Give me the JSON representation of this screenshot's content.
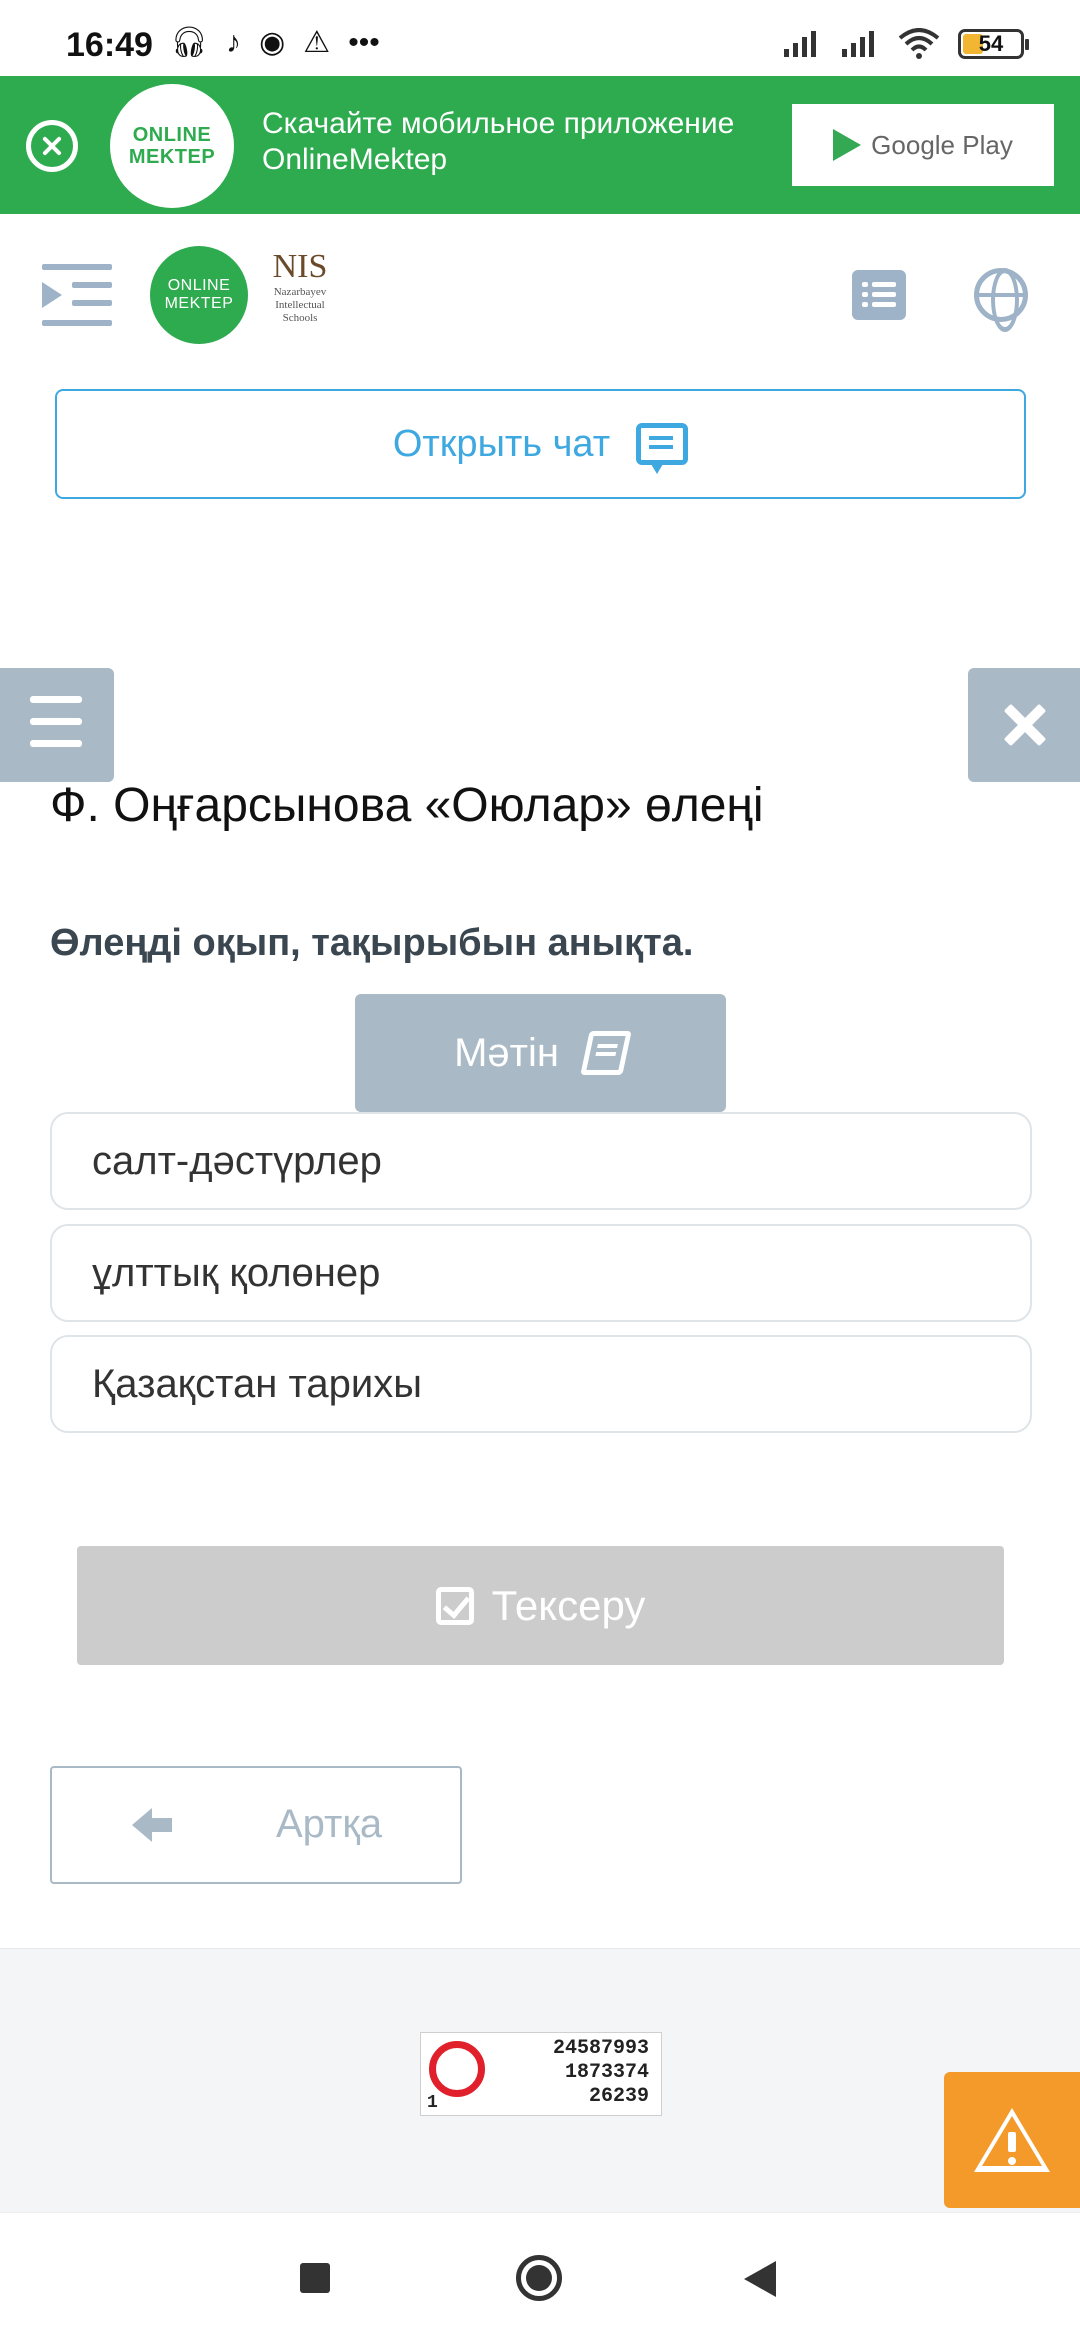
{
  "status_bar": {
    "time": "16:49",
    "battery": "54",
    "icons": [
      "headphones-icon",
      "tiktok-icon",
      "notification-icon",
      "warning-icon",
      "more-icon",
      "signal-icon",
      "signal-icon",
      "wifi-icon",
      "battery-icon"
    ],
    "more": "•••"
  },
  "promo_banner": {
    "text": "Скачайте мобильное приложение OnlineMektep",
    "logo_line1": "ONLINE",
    "logo_line2": "MEKTEP",
    "store_label": "Google Play",
    "background": "#2eab4f"
  },
  "header": {
    "logo_line1": "ONLINE",
    "logo_line2": "MEKTEP",
    "nis_title": "NIS",
    "nis_sub1": "Nazarbayev",
    "nis_sub2": "Intellectual",
    "nis_sub3": "Schools"
  },
  "chat": {
    "label": "Открыть чат",
    "color": "#3ea8e0"
  },
  "lesson": {
    "title": "Ф. Оңғарсынова «Оюлар» өлеңі",
    "question": "Өлеңді оқып, тақырыбын анықта.",
    "text_button": "Мәтін",
    "options": [
      {
        "label": "салт-дәстүрлер"
      },
      {
        "label": "ұлттық қолөнер"
      },
      {
        "label": "Қазақстан тарихы"
      }
    ],
    "check_button": "Тексеру",
    "back_button": "Артқа"
  },
  "footer": {
    "counter_values": [
      "24587993",
      "1873374",
      "26239"
    ],
    "counter_index": "1",
    "report_color": "#f39a2b"
  },
  "colors": {
    "accent_gray": "#a9b9c6",
    "disabled": "#cccccc"
  }
}
